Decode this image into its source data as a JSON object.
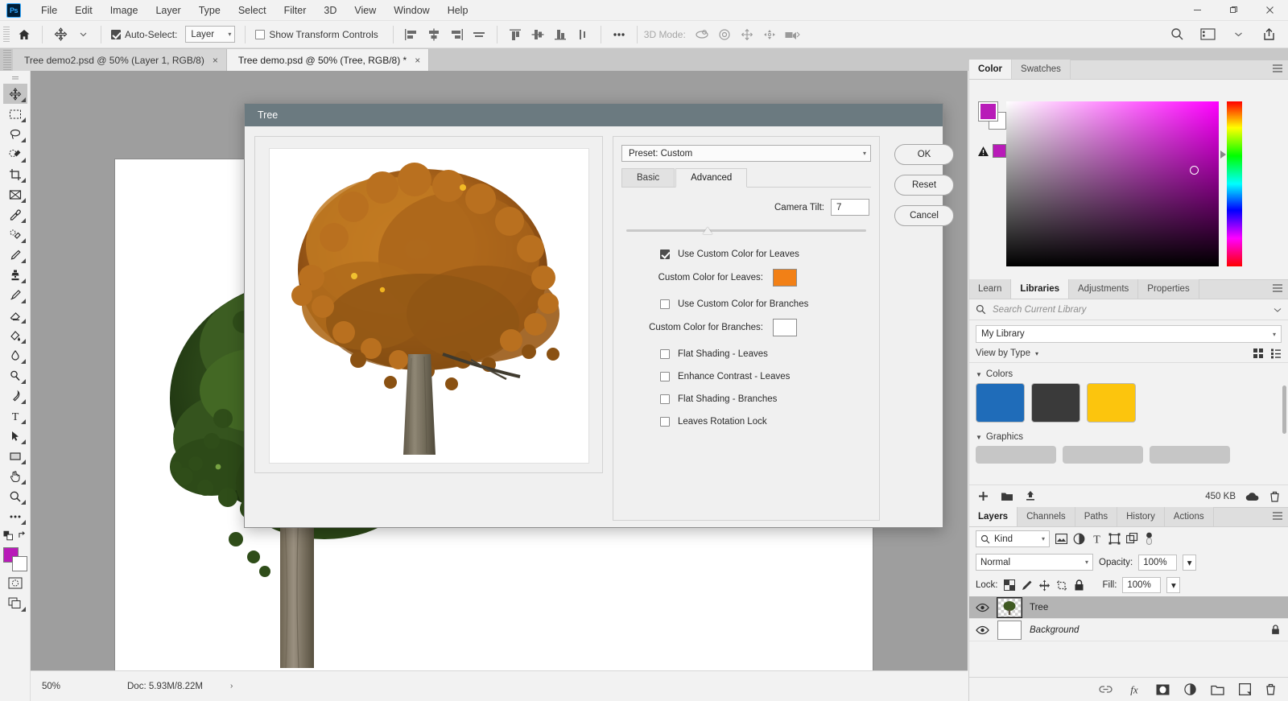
{
  "app": {
    "logo_text": "Ps",
    "menus": [
      "File",
      "Edit",
      "Image",
      "Layer",
      "Type",
      "Select",
      "Filter",
      "3D",
      "View",
      "Window",
      "Help"
    ],
    "window_controls": {
      "minimize": "minimize-icon",
      "maximize": "maximize-icon",
      "close": "close-icon"
    }
  },
  "options_bar": {
    "home_icon": "home-icon",
    "tool_icon": "move-tool-icon",
    "auto_select_label": "Auto-Select:",
    "auto_select_checked": true,
    "auto_select_value": "Layer",
    "show_transform_label": "Show Transform Controls",
    "show_transform_checked": false,
    "align_icons": [
      "align-left-edges-icon",
      "align-horizontal-centers-icon",
      "align-right-edges-icon",
      "distribute-horizontal-icon"
    ],
    "align_icons2": [
      "align-top-edges-icon",
      "align-vertical-centers-icon",
      "align-bottom-edges-icon",
      "distribute-vertical-icon"
    ],
    "more_icon": "more-options-icon",
    "mode_3d_label": "3D Mode:",
    "mode_3d_icons": [
      "orbit-3d-icon",
      "roll-3d-icon",
      "pan-3d-icon",
      "slide-3d-icon",
      "camera-3d-icon"
    ],
    "right_icons": [
      "search-icon",
      "workspace-icon",
      "chevron-down-icon",
      "share-icon"
    ]
  },
  "tabs": [
    {
      "label": "Tree demo2.psd @ 50% (Layer 1, RGB/8)",
      "close": "×",
      "active": false
    },
    {
      "label": "Tree demo.psd @ 50% (Tree, RGB/8) *",
      "close": "×",
      "active": true
    }
  ],
  "toolbar": {
    "tools": [
      {
        "name": "move-tool",
        "active": true
      },
      {
        "name": "rectangular-marquee-tool",
        "active": false
      },
      {
        "name": "lasso-tool",
        "active": false
      },
      {
        "name": "object-selection-tool",
        "active": false
      },
      {
        "name": "crop-tool",
        "active": false
      },
      {
        "name": "frame-tool",
        "active": false
      },
      {
        "name": "eyedropper-tool",
        "active": false
      },
      {
        "name": "spot-healing-brush-tool",
        "active": false
      },
      {
        "name": "brush-tool",
        "active": false
      },
      {
        "name": "clone-stamp-tool",
        "active": false
      },
      {
        "name": "history-brush-tool",
        "active": false
      },
      {
        "name": "eraser-tool",
        "active": false
      },
      {
        "name": "gradient-tool",
        "active": false
      },
      {
        "name": "blur-tool",
        "active": false
      },
      {
        "name": "dodge-tool",
        "active": false
      },
      {
        "name": "pen-tool",
        "active": false
      },
      {
        "name": "type-tool",
        "active": false
      },
      {
        "name": "path-selection-tool",
        "active": false
      },
      {
        "name": "rectangle-tool",
        "active": false
      },
      {
        "name": "hand-tool",
        "active": false
      },
      {
        "name": "zoom-tool",
        "active": false
      },
      {
        "name": "edit-toolbar-more",
        "active": false
      }
    ],
    "foreground_color": "#b81bb8",
    "background_color": "#ffffff",
    "quick_mask_icon": "quick-mask-icon",
    "screen_mode_icon": "screen-mode-icon",
    "swap_colors_icon": "swap-colors-icon",
    "default_colors_icon": "default-colors-icon"
  },
  "status_bar": {
    "zoom": "50%",
    "doc_info": "Doc: 5.93M/8.22M",
    "expand_arrow": "›"
  },
  "dialog": {
    "title": "Tree",
    "preset_label": "Preset: Custom",
    "tabs": [
      {
        "label": "Basic",
        "active": false
      },
      {
        "label": "Advanced",
        "active": true
      }
    ],
    "camera_tilt_label": "Camera Tilt:",
    "camera_tilt_value": "7",
    "options": [
      {
        "label": "Use Custom Color for Leaves",
        "checked": true,
        "disabled": false
      },
      {
        "label": "Use Custom Color for Branches",
        "checked": false,
        "disabled": false
      },
      {
        "label": "Flat Shading - Leaves",
        "checked": false,
        "disabled": false
      },
      {
        "label": "Enhance Contrast - Leaves",
        "checked": false,
        "disabled": false
      },
      {
        "label": "Flat Shading - Branches",
        "checked": false,
        "disabled": false
      },
      {
        "label": "Leaves Rotation Lock",
        "checked": false,
        "disabled": false
      }
    ],
    "leaves_color_label": "Custom Color for Leaves:",
    "leaves_color_value": "#f28016",
    "branches_color_label": "Custom Color for Branches:",
    "branches_color_value": "#ffffff",
    "buttons": [
      {
        "label": "OK",
        "name": "ok-button"
      },
      {
        "label": "Reset",
        "name": "reset-button"
      },
      {
        "label": "Cancel",
        "name": "cancel-button"
      }
    ]
  },
  "color_panel": {
    "tabs": [
      {
        "label": "Color",
        "active": true
      },
      {
        "label": "Swatches",
        "active": false
      }
    ],
    "foreground_color": "#b81bb8",
    "background_color": "#ffffff",
    "alert_icon": "out-of-gamut-warning-icon",
    "alert_color": "#b81bb8",
    "menu_icon": "panel-menu-icon"
  },
  "libraries_panel": {
    "tabs": [
      {
        "label": "Learn",
        "active": false
      },
      {
        "label": "Libraries",
        "active": true
      },
      {
        "label": "Adjustments",
        "active": false
      },
      {
        "label": "Properties",
        "active": false
      }
    ],
    "search_placeholder": "Search Current Library",
    "search_icon": "search-icon",
    "library_name": "My Library",
    "view_label": "View by Type",
    "view_icons": [
      "grid-view-icon",
      "list-view-icon"
    ],
    "sections": [
      {
        "title": "Colors",
        "swatches": [
          "#1f6cb9",
          "#3a3a3a",
          "#fcc50d"
        ]
      },
      {
        "title": "Graphics",
        "items": [
          "graphic-1",
          "graphic-2",
          "graphic-3"
        ]
      }
    ],
    "footer": {
      "add_icon": "add-content-icon",
      "folder_icon": "new-library-icon",
      "upload_icon": "upload-icon",
      "size_label": "450 KB",
      "cloud_icon": "cloud-sync-icon",
      "delete_icon": "delete-icon"
    },
    "menu_icon": "panel-menu-icon"
  },
  "layers_panel": {
    "tabs": [
      {
        "label": "Layers",
        "active": true
      },
      {
        "label": "Channels",
        "active": false
      },
      {
        "label": "Paths",
        "active": false
      },
      {
        "label": "History",
        "active": false
      },
      {
        "label": "Actions",
        "active": false
      }
    ],
    "filter_label": "Kind",
    "filter_icons": [
      "pixel-layers-filter-icon",
      "adjustment-layers-filter-icon",
      "type-layers-filter-icon",
      "shape-layers-filter-icon",
      "smart-object-filter-icon",
      "filter-toggle-icon"
    ],
    "blend_mode": "Normal",
    "opacity_label": "Opacity:",
    "opacity_value": "100%",
    "lock_label": "Lock:",
    "lock_icons": [
      "lock-transparent-pixels-icon",
      "lock-image-pixels-icon",
      "lock-position-icon",
      "lock-artboard-icon",
      "lock-all-icon"
    ],
    "fill_label": "Fill:",
    "fill_value": "100%",
    "layers": [
      {
        "name": "Tree",
        "visible": true,
        "selected": true,
        "locked": false,
        "italic": false
      },
      {
        "name": "Background",
        "visible": true,
        "selected": false,
        "locked": true,
        "italic": true
      }
    ],
    "footer_icons": [
      "link-layers-icon",
      "layer-style-icon",
      "layer-mask-icon",
      "adjustment-layer-icon",
      "new-group-icon",
      "new-layer-icon",
      "delete-layer-icon"
    ],
    "menu_icon": "panel-menu-icon"
  }
}
